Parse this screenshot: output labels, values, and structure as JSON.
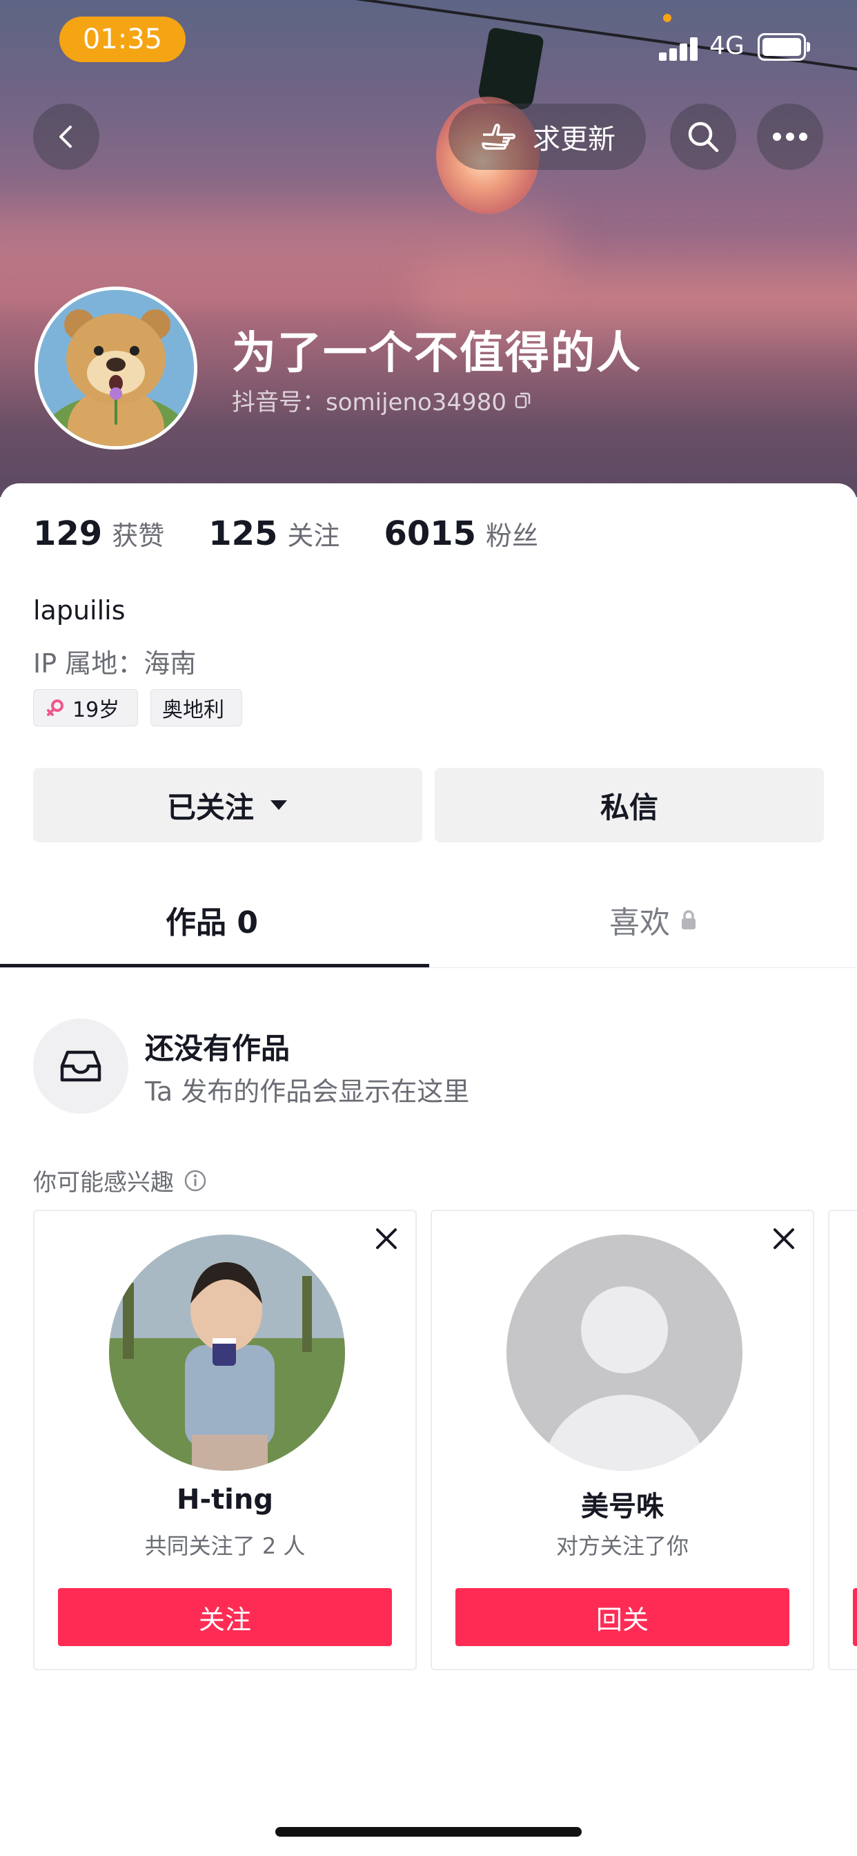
{
  "status_bar": {
    "time": "01:35",
    "network": "4G"
  },
  "header": {
    "request_update_label": "求更新",
    "username": "为了一个不值得的人",
    "douyin_id_label": "抖音号：somijeno34980"
  },
  "stats": [
    {
      "value": "129",
      "label": "获赞"
    },
    {
      "value": "125",
      "label": "关注"
    },
    {
      "value": "6015",
      "label": "粉丝"
    }
  ],
  "profile": {
    "bio": "lapuilis",
    "ip_location": "IP 属地：海南",
    "tags": [
      {
        "text": "19岁",
        "icon": "female-icon"
      },
      {
        "text": "奥地利"
      }
    ]
  },
  "actions": {
    "followed_label": "已关注",
    "message_label": "私信"
  },
  "tabs": [
    {
      "label": "作品 0",
      "active": true
    },
    {
      "label": "喜欢",
      "locked": true
    }
  ],
  "empty_state": {
    "title": "还没有作品",
    "subtitle": "Ta 发布的作品会显示在这里"
  },
  "suggestions": {
    "title": "你可能感兴趣",
    "cards": [
      {
        "name": "H-ting",
        "desc": "共同关注了 2 人",
        "action": "关注"
      },
      {
        "name": "美号咮",
        "desc": "对方关注了你",
        "action": "回关"
      }
    ]
  },
  "colors": {
    "accent": "#fe2c55",
    "status_pill": "#f5a413"
  }
}
